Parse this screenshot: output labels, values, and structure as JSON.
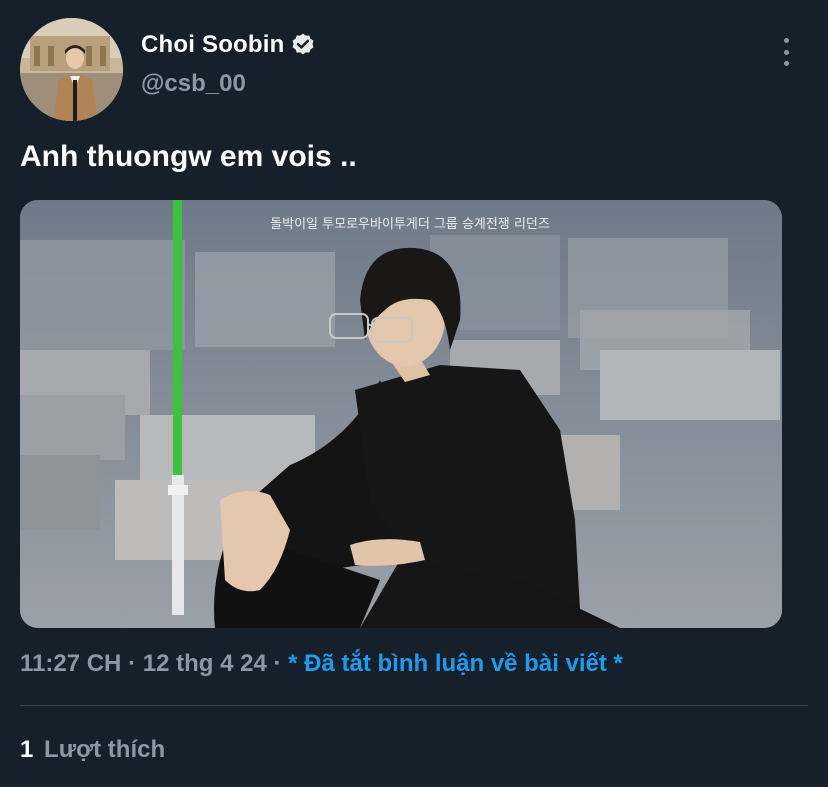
{
  "author": {
    "display_name": "Choi Soobin",
    "handle": "@csb_00",
    "verified": true,
    "avatar_icon": "profile-photo"
  },
  "tweet": {
    "text": "Anh thuongw em vois ..",
    "media": {
      "watermark": "돌박이일 투모로우바이투게더 그룹 승계전쟁 리던즈"
    }
  },
  "meta": {
    "time": "11:27 CH",
    "separator": "·",
    "date": "12 thg 4 24",
    "replies_status": "* Đã tắt bình luận về bài viết *"
  },
  "stats": {
    "likes_count": "1",
    "likes_label": "Lượt thích"
  },
  "colors": {
    "background": "#15202b",
    "text_primary": "#ffffff",
    "text_secondary": "#8b98a5",
    "accent": "#1d9bf0",
    "divider": "#38444d"
  }
}
